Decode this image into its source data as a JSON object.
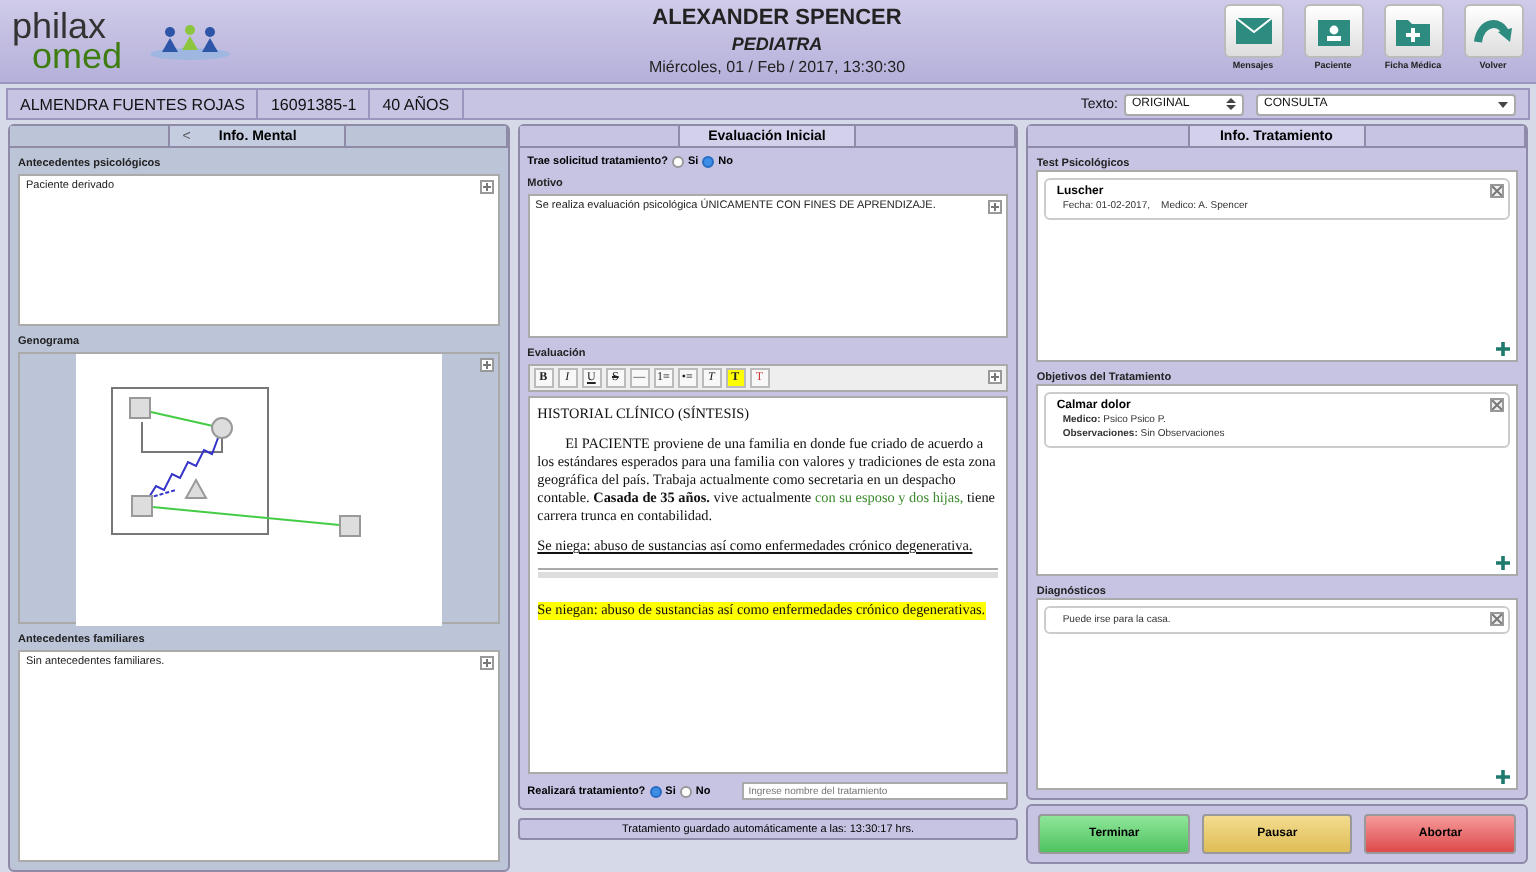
{
  "header": {
    "logo_top": "philax",
    "logo_bottom": "omed",
    "doctor": "ALEXANDER SPENCER",
    "specialty": "PEDIATRA",
    "datetime": "Miércoles, 01 / Feb / 2017, 13:30:30",
    "actions": [
      {
        "kind": "mail",
        "label": "Mensajes"
      },
      {
        "kind": "patient",
        "label": "Paciente"
      },
      {
        "kind": "folder-plus",
        "label": "Ficha Médica"
      },
      {
        "kind": "back",
        "label": "Volver"
      }
    ]
  },
  "patient": {
    "name": "ALMENDRA FUENTES ROJAS",
    "id": "16091385-1",
    "age": "40 AÑOS",
    "text_label": "Texto:",
    "text_select": "ORIGINAL",
    "mode_select": "CONSULTA"
  },
  "left": {
    "tab": "Info. Mental",
    "back": "<",
    "psych_label": "Antecedentes psicológicos",
    "psych_text": "Paciente derivado",
    "genogram_label": "Genograma",
    "family_label": "Antecedentes familiares",
    "family_text": "Sin antecedentes familiares."
  },
  "middle": {
    "tab": "Evaluación Inicial",
    "request_label": "Trae solicitud tratamiento?",
    "request_options": [
      {
        "label": "Si",
        "selected": false
      },
      {
        "label": "No",
        "selected": true
      }
    ],
    "motivo_label": "Motivo",
    "motivo_text": "Se realiza evaluación psicológica ÚNICAMENTE CON FINES DE APRENDIZAJE.",
    "eval_label": "Evaluación",
    "toolbar": [
      "B",
      "I",
      "U",
      "S",
      "—",
      "1≡",
      "•≡",
      "T",
      "T",
      "T"
    ],
    "editor": [
      {
        "kind": "title",
        "segments": [
          {
            "kind": "plain",
            "text": "HISTORIAL CLÍNICO (SÍNTESIS)"
          }
        ]
      },
      {
        "kind": "paragraph",
        "segments": [
          {
            "kind": "plain",
            "text": "El PACIENTE proviene de una familia en donde fue criado de acuerdo a los estándares esperados para una familia con valores y tradiciones de esta zona geográfica del país. Trabaja actualmente como secretaria en un despacho contable. "
          },
          {
            "kind": "bold",
            "text": "Casada de 35 años."
          },
          {
            "kind": "plain",
            "text": " vive actualmente "
          },
          {
            "kind": "green",
            "text": "con su esposo y dos hijas,"
          },
          {
            "kind": "plain",
            "text": " tiene carrera trunca en contabilidad."
          }
        ]
      },
      {
        "kind": "underlined",
        "segments": [
          {
            "kind": "plain",
            "text": "Se niega: abuso de sustancias así como enfermedades crónico degenerativa."
          }
        ]
      },
      {
        "kind": "rule"
      },
      {
        "kind": "highlight",
        "segments": [
          {
            "kind": "plain",
            "text": "Se niegan: abuso de sustancias así como enfermedades crónico degenerativas."
          }
        ]
      }
    ],
    "treatment_label": "Realizará tratamiento?",
    "treatment_options": [
      {
        "label": "Si",
        "selected": true
      },
      {
        "label": "No",
        "selected": false
      }
    ],
    "treatment_placeholder": "Ingrese nombre del tratamiento",
    "status": "Tratamiento guardado automáticamente a las: 13:30:17 hrs."
  },
  "right": {
    "tab": "Info. Tratamiento",
    "sections": [
      {
        "label": "Test Psicológicos",
        "cards": [
          {
            "title": "Luscher",
            "lines": [
              {
                "value": "Fecha: 01-02-2017,    Medico: A. Spencer"
              }
            ]
          }
        ]
      },
      {
        "label": "Objetivos del Tratamiento",
        "cards": [
          {
            "title": "Calmar dolor",
            "lines": [
              {
                "key": "Medico:",
                "value": "Psico Psico P."
              },
              {
                "key": "Observaciones:",
                "value": "Sin Observaciones"
              }
            ]
          }
        ]
      },
      {
        "label": "Diagnósticos",
        "cards": [
          {
            "lines": [
              {
                "value": "Puede irse para la casa."
              }
            ]
          }
        ]
      }
    ]
  },
  "buttons": [
    {
      "kind": "finish",
      "label": "Terminar"
    },
    {
      "kind": "pause",
      "label": "Pausar"
    },
    {
      "kind": "abort",
      "label": "Abortar"
    }
  ]
}
